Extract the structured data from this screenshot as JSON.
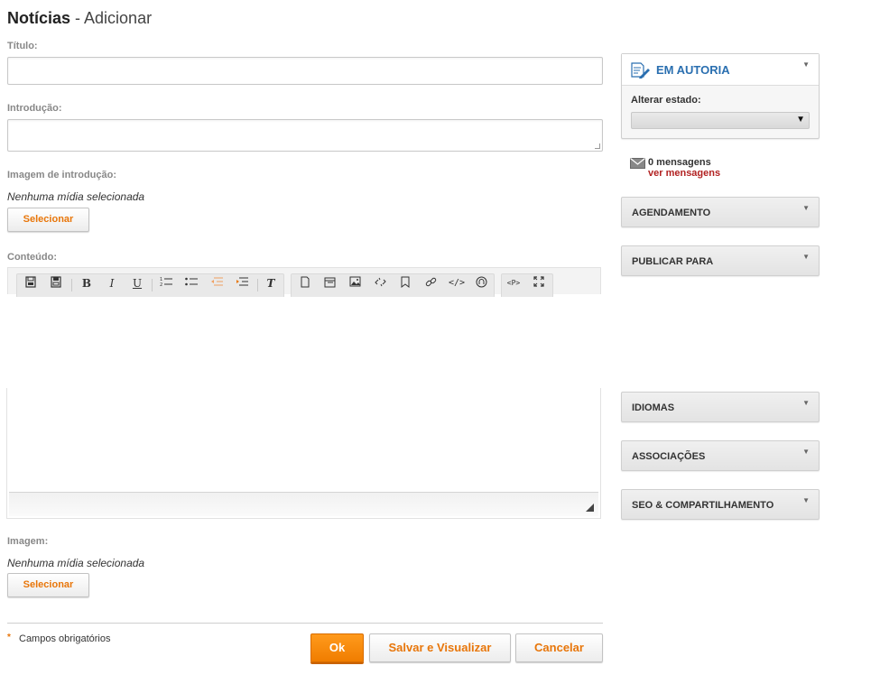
{
  "page": {
    "title_main": "Notícias",
    "title_sub": " - Adicionar"
  },
  "form": {
    "titulo_label": "Título:",
    "titulo_value": "",
    "introducao_label": "Introdução:",
    "introducao_value": "",
    "imagem_intro_label": "Imagem de introdução:",
    "imagem_intro_note": "Nenhuma mídia selecionada",
    "imagem_intro_button": "Selecionar",
    "conteudo_label": "Conteúdo:",
    "imagem_label": "Imagem:",
    "imagem_note": "Nenhuma mídia selecionada",
    "imagem_button": "Selecionar",
    "required_mark": "*",
    "required_note": "Campos obrigatórios"
  },
  "editor": {
    "toolbar_icons": [
      "save-icon",
      "save-draft-icon",
      "bold-icon",
      "italic-icon",
      "underline-icon",
      "numbered-list-icon",
      "bullet-list-icon",
      "outdent-icon",
      "indent-icon",
      "remove-format-icon",
      "new-page-icon",
      "templates-icon",
      "image-icon",
      "unlink-icon",
      "bookmark-icon",
      "link-icon",
      "source-code-icon",
      "special-char-icon",
      "html-tag-icon",
      "maximize-icon"
    ],
    "glyphs": {
      "bold": "B",
      "italic": "I",
      "underline": "U",
      "clear_format": "T",
      "tag": "<P>",
      "source": "</>"
    }
  },
  "sidebar": {
    "status_panel": {
      "title": "EM AUTORIA",
      "alter_label": "Alterar estado:",
      "select_value": ""
    },
    "messages": {
      "count_text": "0 mensagens",
      "link_text": "ver mensagens"
    },
    "panels": [
      {
        "title": "AGENDAMENTO"
      },
      {
        "title": "PUBLICAR PARA"
      },
      {
        "title": "IDIOMAS"
      },
      {
        "title": "ASSOCIAÇÕES"
      },
      {
        "title": "SEO & COMPARTILHAMENTO"
      }
    ]
  },
  "actions": {
    "ok": "Ok",
    "save_view": "Salvar e Visualizar",
    "cancel": "Cancelar"
  },
  "colors": {
    "accent": "#e8760a",
    "ok_button": "#f7890c",
    "link_red": "#b22222",
    "panel_title_blue": "#2a6fb0"
  }
}
